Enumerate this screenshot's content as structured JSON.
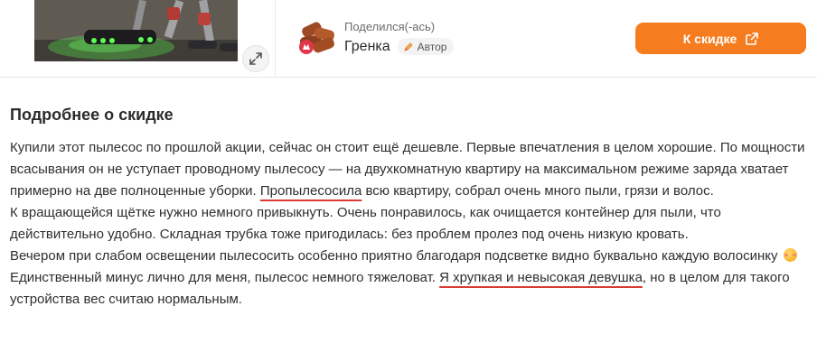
{
  "product": {
    "image_alt": "Беспроводной пылесос с подсветкой"
  },
  "author": {
    "shared_label": "Поделился(-ась)",
    "name": "Гренка",
    "badge_label": "Автор",
    "avatar_icon": "toast-avatar-icon"
  },
  "deal_button": {
    "label": "К скидке",
    "icon": "external-link-icon",
    "color": "#f57d1f"
  },
  "description": {
    "title": "Подробнее о скидке",
    "paragraphs": [
      {
        "pre": "Купили этот пылесос по прошлой акции, сейчас он стоит ещё дешевле. Первые впечатления в целом хорошие. По мощности всасывания он не уступает проводному пылесосу — на двухкомнатную квартиру на максимальном режиме заряда хватает примерно на две полноценные уборки. ",
        "marked": "Пропылесосила",
        "post": " всю квартиру, собрал очень много пыли, грязи и волос."
      },
      {
        "text": "К вращающейся щётке нужно немного привыкнуть. Очень понравилось, как очищается контейнер для пыли, что действительно удобно. Складная трубка тоже пригодилась: без проблем пролез под очень низкую кровать."
      },
      {
        "text": "Вечером при слабом освещении пылесосить особенно приятно благодаря подсветке видно буквально каждую волосинку",
        "emoji": "blushing-face-icon"
      },
      {
        "pre": "Единственный минус лично для меня, пылесос немного тяжеловат. ",
        "marked": "Я хрупкая и невысокая девушка",
        "post": ", но в целом для такого устройства вес считаю нормальным."
      }
    ],
    "highlight_color": "#d93b34"
  }
}
